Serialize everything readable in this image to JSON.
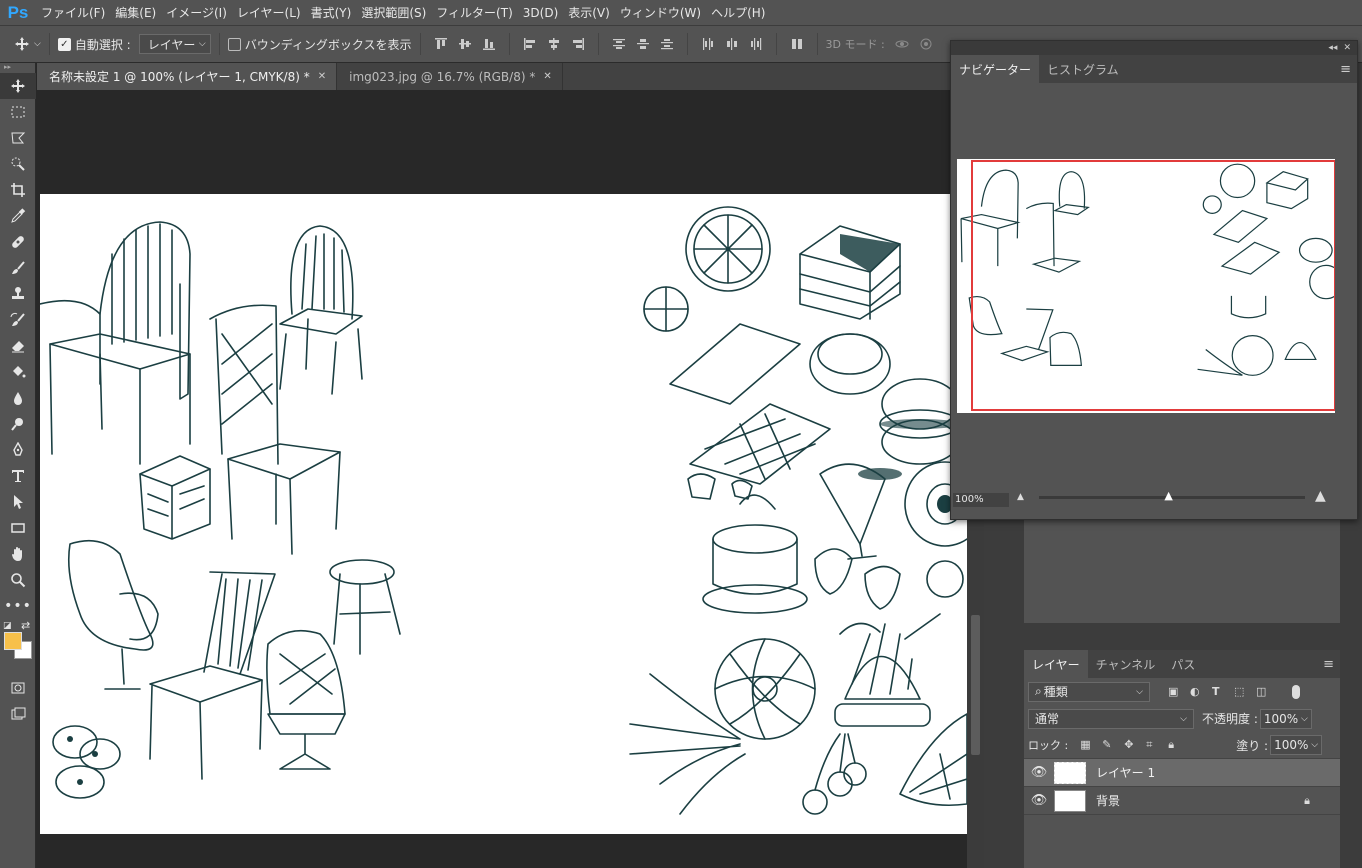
{
  "app": {
    "logo": "Ps"
  },
  "menu": [
    "ファイル(F)",
    "編集(E)",
    "イメージ(I)",
    "レイヤー(L)",
    "書式(Y)",
    "選択範囲(S)",
    "フィルター(T)",
    "3D(D)",
    "表示(V)",
    "ウィンドウ(W)",
    "ヘルプ(H)"
  ],
  "options": {
    "auto_select_label": "自動選択 :",
    "auto_select_checked": true,
    "target_value": "レイヤー",
    "bounding_box_label": "バウンディングボックスを表示",
    "bounding_box_checked": false,
    "mode_3d_label": "3D モード :"
  },
  "document_tabs": [
    {
      "label": "名称未設定 1 @ 100% (レイヤー 1, CMYK/8) *",
      "active": true
    },
    {
      "label": "img023.jpg @ 16.7% (RGB/8) *",
      "active": false
    }
  ],
  "tools": [
    "move-icon",
    "marquee-icon",
    "lasso-icon",
    "quick-select-icon",
    "crop-icon",
    "eyedropper-icon",
    "healing-icon",
    "brush-icon",
    "stamp-icon",
    "history-brush-icon",
    "eraser-icon",
    "paint-bucket-icon",
    "blur-icon",
    "dodge-icon",
    "pen-icon",
    "type-icon",
    "path-select-icon",
    "rectangle-icon",
    "hand-icon",
    "zoom-icon",
    "more-tools-icon"
  ],
  "colors": {
    "foreground": "#f7c04a",
    "background": "#ffffff",
    "nav_rect": "#e23b3b",
    "ink": "#1b3f42"
  },
  "navigator": {
    "tabs": [
      "ナビゲーター",
      "ヒストグラム"
    ],
    "zoom": "100%",
    "zoom_level_fraction": 0.49
  },
  "layers_panel": {
    "tabs": [
      "レイヤー",
      "チャンネル",
      "パス"
    ],
    "filter_kind": "種類",
    "blend_mode": "通常",
    "opacity_label": "不透明度 :",
    "opacity_value": "100%",
    "lock_label": "ロック :",
    "fill_label": "塗り :",
    "fill_value": "100%",
    "layers": [
      {
        "name": "レイヤー 1",
        "selected": true,
        "locked": false
      },
      {
        "name": "背景",
        "selected": false,
        "locked": true
      }
    ]
  }
}
